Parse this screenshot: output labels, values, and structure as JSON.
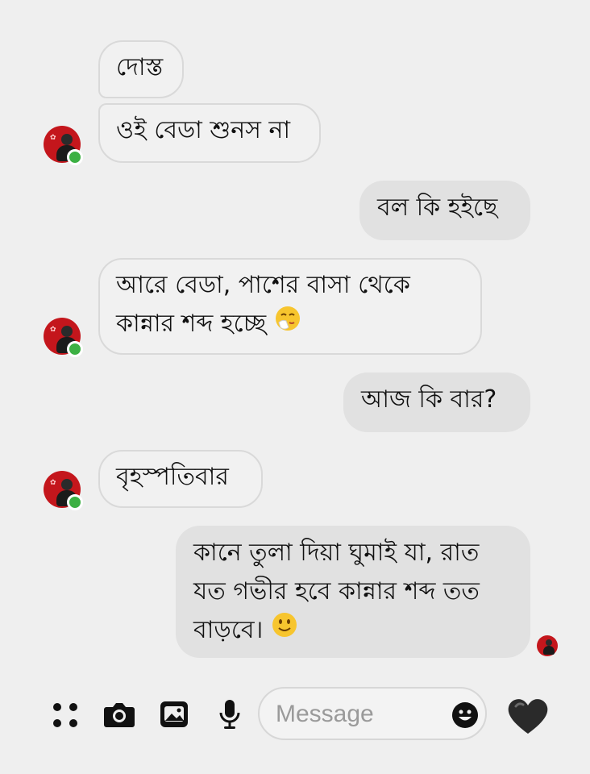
{
  "conversation": {
    "messages": [
      {
        "sender": "other",
        "text": "দোস্ত"
      },
      {
        "sender": "other",
        "text": "ওই বেডা শুনস না"
      },
      {
        "sender": "me",
        "text": "বল কি হইছে"
      },
      {
        "sender": "other",
        "lines": [
          "আরে বেডা, পাশের বাসা থেকে",
          "কান্নার শব্দ হচ্ছে"
        ],
        "emoji": "face-with-hand-over-mouth"
      },
      {
        "sender": "me",
        "text": "আজ কি বার?"
      },
      {
        "sender": "other",
        "text": "বৃহস্পতিবার"
      },
      {
        "sender": "me",
        "lines": [
          "কানে তুলা দিয়া ঘুমাই যা, রাত",
          "যত গভীর হবে কান্নার শব্দ তত",
          "বাড়বে।"
        ],
        "emoji": "slightly-smiling-face"
      }
    ]
  },
  "composer": {
    "placeholder": "Message",
    "icons": [
      "more-apps-icon",
      "camera-icon",
      "gallery-icon",
      "microphone-icon",
      "emoji-icon",
      "heart-icon"
    ]
  },
  "colors": {
    "background": "#efefef",
    "incoming_bubble": "#f1f1f1",
    "outgoing_bubble": "#e1e1e1",
    "avatar": "#c4161c",
    "online": "#3cb043",
    "heart": "#2a2a2a"
  }
}
